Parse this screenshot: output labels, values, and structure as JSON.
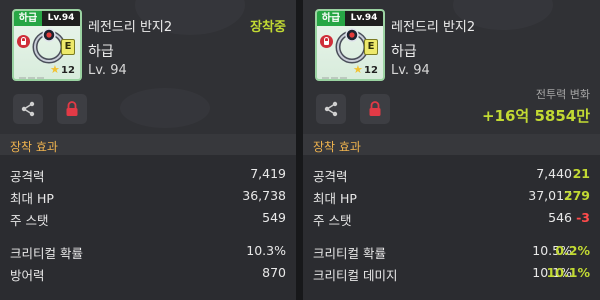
{
  "left": {
    "item_name": "레전드리 반지2",
    "status": "장착중",
    "grade": "하급",
    "grade_badge": "하급",
    "level_badge": "Lv.94",
    "level": "Lv. 94",
    "rank_letter": "E",
    "star_count": "12",
    "section_title": "장착 효과",
    "stats": [
      {
        "label": "공격력",
        "value": "7,419"
      },
      {
        "label": "최대 HP",
        "value": "36,738"
      },
      {
        "label": "주 스탯",
        "value": "549"
      },
      {
        "label": "크리티컬 확률",
        "value": "10.3%"
      },
      {
        "label": "방어력",
        "value": "870"
      }
    ]
  },
  "right": {
    "item_name": "레전드리 반지2",
    "grade": "하급",
    "grade_badge": "하급",
    "level_badge": "Lv.94",
    "level": "Lv. 94",
    "rank_letter": "E",
    "star_count": "12",
    "power_change_label": "전투력 변화",
    "power_change_value": "+16억 5854만",
    "section_title": "장착 효과",
    "stats": [
      {
        "label": "공격력",
        "value": "7,440",
        "delta": "21",
        "direction": "up"
      },
      {
        "label": "최대 HP",
        "value": "37,017",
        "delta": "279",
        "direction": "up"
      },
      {
        "label": "주 스탯",
        "value": "546",
        "delta": "-3",
        "direction": "down"
      },
      {
        "label": "크리티컬 확률",
        "value": "10.5%",
        "delta": "0.2%",
        "direction": "up"
      },
      {
        "label": "크리티컬 데미지",
        "value": "10.1%",
        "delta": "10.1%",
        "direction": "up"
      }
    ]
  },
  "icons": {
    "share": "share-icon",
    "lock": "lock-icon",
    "ring": "ring-icon",
    "star": "star-icon"
  },
  "colors": {
    "accent_green": "#c2da33",
    "section_orange": "#eeb24e",
    "negative_red": "#ff4b4b",
    "lock_red": "#cf2e39",
    "grade_green": "#27a645"
  }
}
